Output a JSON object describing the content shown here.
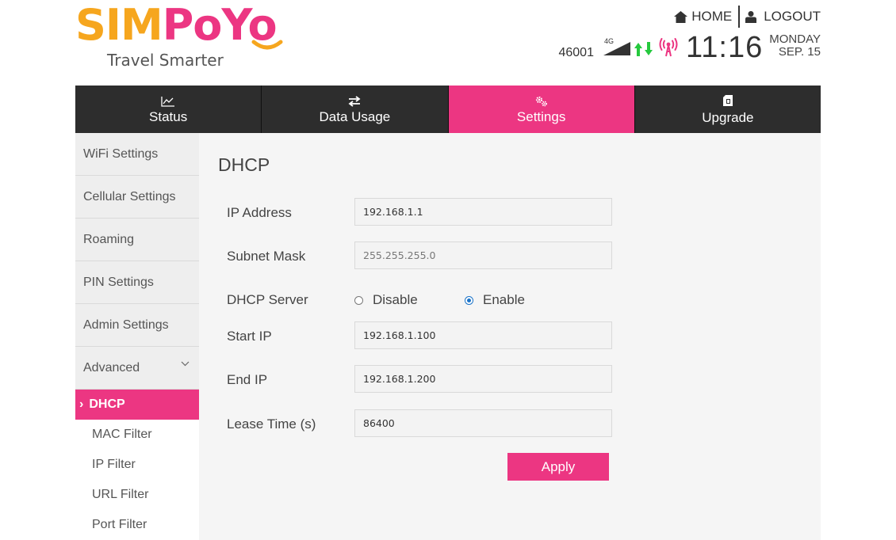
{
  "brand": {
    "logo_part1": "SIM",
    "logo_part2": "PoYo",
    "tagline": "Travel Smarter",
    "primary_color": "#ec3682",
    "secondary_color": "#f6a61e"
  },
  "header": {
    "home_label": "HOME",
    "logout_label": "LOGOUT",
    "network_code": "46001",
    "network_type": "4G",
    "time": "11:16",
    "weekday": "MONDAY",
    "date": "SEP. 15"
  },
  "tabs": [
    {
      "label": "Status",
      "icon": "chart-icon"
    },
    {
      "label": "Data Usage",
      "icon": "transfer-icon"
    },
    {
      "label": "Settings",
      "icon": "gears-icon",
      "active": true
    },
    {
      "label": "Upgrade",
      "icon": "sim-card-icon"
    }
  ],
  "sidebar": {
    "items": [
      "WiFi Settings",
      "Cellular Settings",
      "Roaming",
      "PIN Settings",
      "Admin Settings",
      "Advanced"
    ],
    "sub_items": [
      "DHCP",
      "MAC Filter",
      "IP Filter",
      "URL Filter",
      "Port Filter"
    ],
    "active_sub": "DHCP"
  },
  "main": {
    "title": "DHCP",
    "labels": {
      "ip_address": "IP Address",
      "subnet_mask": "Subnet Mask",
      "dhcp_server": "DHCP Server",
      "start_ip": "Start IP",
      "end_ip": "End IP",
      "lease_time": "Lease Time (s)"
    },
    "values": {
      "ip_address": "192.168.1.1",
      "subnet_mask": "255.255.255.0",
      "start_ip": "192.168.1.100",
      "end_ip": "192.168.1.200",
      "lease_time": "86400"
    },
    "dhcp_options": {
      "disable": "Disable",
      "enable": "Enable",
      "selected": "enable"
    },
    "apply_label": "Apply"
  }
}
